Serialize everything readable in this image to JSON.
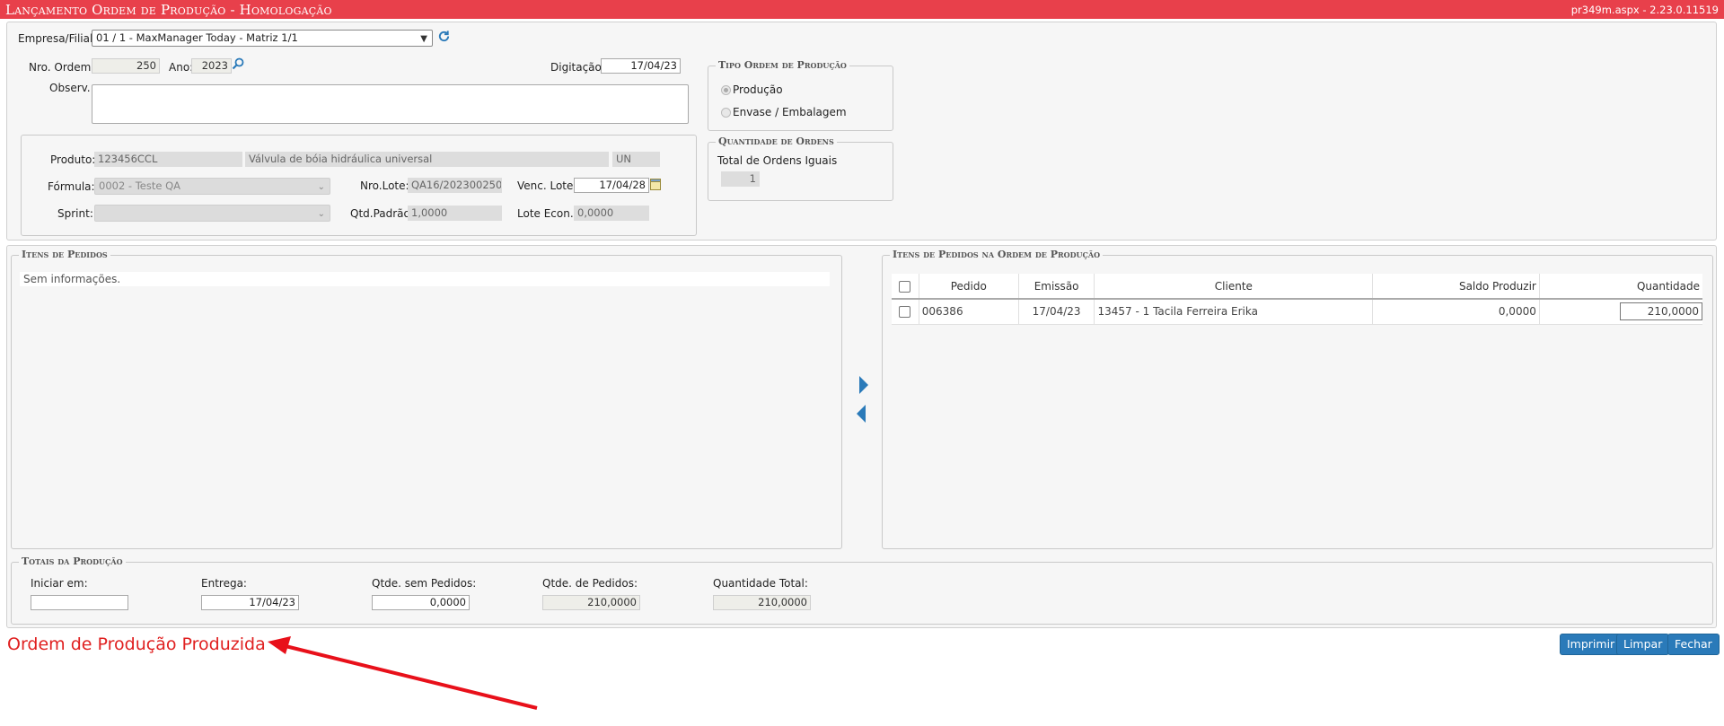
{
  "window": {
    "title": "Lançamento Ordem de Produção  - Homologação",
    "version": "pr349m.aspx - 2.23.0.11519"
  },
  "header": {
    "empresa_label": "Empresa/Filial:",
    "empresa_value": "01 / 1 - MaxManager Today - Matriz 1/1",
    "nro_ordem_label": "Nro. Ordem:",
    "nro_ordem_value": "250",
    "ano_label": "Ano:",
    "ano_value": "2023",
    "digitacao_label": "Digitação:",
    "digitacao_value": "17/04/23",
    "observ_label": "Observ.:",
    "observ_value": ""
  },
  "produto": {
    "produto_label": "Produto:",
    "codigo": "123456CCL",
    "descricao": "Válvula de bóia hidráulica universal",
    "unidade": "UN",
    "formula_label": "Fórmula:",
    "formula_value": "0002 - Teste QA",
    "nro_lote_label": "Nro.Lote:",
    "nro_lote_value": "QA16/202300250",
    "venc_lote_label": "Venc. Lote:",
    "venc_lote_value": "17/04/28",
    "sprint_label": "Sprint:",
    "sprint_value": "",
    "qtd_padrao_label": "Qtd.Padrão:",
    "qtd_padrao_value": "1,0000",
    "lote_econ_label": "Lote Econ.:",
    "lote_econ_value": "0,0000"
  },
  "tipo_ordem": {
    "legend": "Tipo Ordem de Produção",
    "opt_producao": "Produção",
    "opt_envase": "Envase / Embalagem"
  },
  "quantidade_ordens": {
    "legend": "Quantidade de Ordens",
    "label": "Total de Ordens Iguais",
    "value": "1"
  },
  "itens_pedidos": {
    "legend": "Itens de Pedidos",
    "empty_text": "Sem informações."
  },
  "itens_ordem": {
    "legend": "Itens de Pedidos na Ordem de Produção",
    "columns": [
      "Pedido",
      "Emissão",
      "Cliente",
      "Saldo Produzir",
      "Quantidade"
    ],
    "rows": [
      {
        "pedido": "006386",
        "emissao": "17/04/23",
        "cliente": "13457 - 1 Tacila Ferreira Erika",
        "saldo": "0,0000",
        "quantidade": "210,0000"
      }
    ]
  },
  "totais": {
    "legend": "Totais da Produção",
    "iniciar_label": "Iniciar em:",
    "iniciar_value": "",
    "entrega_label": "Entrega:",
    "entrega_value": "17/04/23",
    "sem_pedidos_label": "Qtde. sem Pedidos:",
    "sem_pedidos_value": "0,0000",
    "de_pedidos_label": "Qtde. de Pedidos:",
    "de_pedidos_value": "210,0000",
    "total_label": "Quantidade Total:",
    "total_value": "210,0000"
  },
  "status_text": "Ordem de Produção Produzida",
  "buttons": {
    "imprimir": "Imprimir",
    "limpar": "Limpar",
    "fechar": "Fechar"
  },
  "colors": {
    "titlebar": "#e8404b",
    "button": "#2a7ab9",
    "status": "#e02020",
    "annotation_arrow": "#e8101a"
  },
  "icons": [
    "refresh-icon",
    "search-icon",
    "calendar-icon",
    "arrow-right-icon",
    "arrow-left-icon",
    "annotation-arrow"
  ]
}
